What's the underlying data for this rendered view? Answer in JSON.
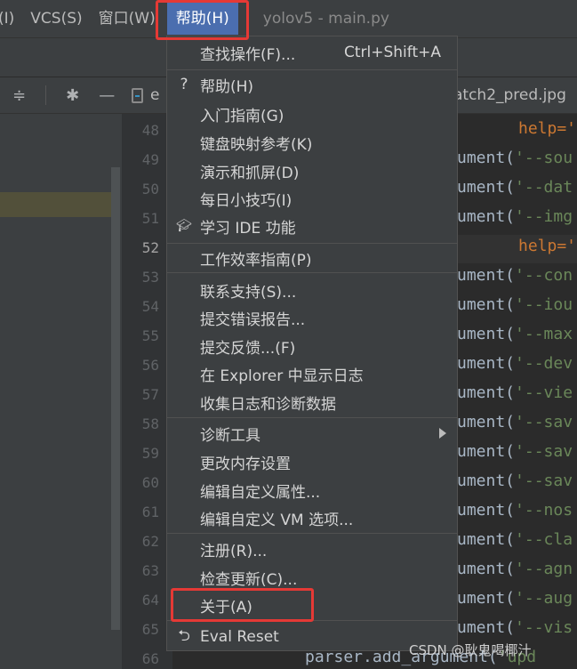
{
  "menubar": {
    "items": [
      "(I)",
      "VCS(S)",
      "窗口(W)"
    ],
    "active_item": "帮助(H)",
    "window_title": "yolov5 - main.py"
  },
  "editor": {
    "tab_left_fragment": "e",
    "tab_right_fragment": "atch2_pred.jpg",
    "line_numbers": [
      "48",
      "49",
      "50",
      "51",
      "52",
      "53",
      "54",
      "55",
      "56",
      "57",
      "58",
      "59",
      "60",
      "61",
      "62",
      "63",
      "64",
      "65",
      "66"
    ],
    "current_line": "52",
    "code_lines": [
      {
        "prefix": "",
        "arg": "help='"
      },
      {
        "prefix": "ument(",
        "arg": "'--sou"
      },
      {
        "prefix": "ument(",
        "arg": "'--dat"
      },
      {
        "prefix": "ument(",
        "arg": "'--img"
      },
      {
        "prefix": "",
        "arg": "help='"
      },
      {
        "prefix": "ument(",
        "arg": "'--con"
      },
      {
        "prefix": "ument(",
        "arg": "'--iou"
      },
      {
        "prefix": "ument(",
        "arg": "'--max"
      },
      {
        "prefix": "ument(",
        "arg": "'--dev"
      },
      {
        "prefix": "ument(",
        "arg": "'--vie"
      },
      {
        "prefix": "ument(",
        "arg": "'--sav"
      },
      {
        "prefix": "ument(",
        "arg": "'--sav"
      },
      {
        "prefix": "ument(",
        "arg": "'--sav"
      },
      {
        "prefix": "ument(",
        "arg": "'--nos"
      },
      {
        "prefix": "ument(",
        "arg": "'--cla"
      },
      {
        "prefix": "ument(",
        "arg": "'--agn"
      },
      {
        "prefix": "ument(",
        "arg": "'--aug"
      },
      {
        "prefix": "ument(",
        "arg": "'--vis"
      },
      {
        "prefix": "parser.add_argument(",
        "arg": "'upd"
      }
    ]
  },
  "help_menu": {
    "find_action": {
      "label": "查找操作(F)...",
      "shortcut": "Ctrl+Shift+A"
    },
    "help": "帮助(H)",
    "getting_started": "入门指南(G)",
    "keymap_reference": "键盘映射参考(K)",
    "demos_screencasts": "演示和抓屏(D)",
    "tip_of_day": "每日小技巧(I)",
    "learn_ide": "学习 IDE 功能",
    "productivity_guide": "工作效率指南(P)",
    "contact_support": "联系支持(S)...",
    "submit_bug": "提交错误报告...",
    "submit_feedback": "提交反馈...(F)",
    "show_log": "在 Explorer 中显示日志",
    "collect_logs": "收集日志和诊断数据",
    "diagnostic_tools": "诊断工具",
    "change_memory": "更改内存设置",
    "edit_properties": "编辑自定义属性...",
    "edit_vm_options": "编辑自定义 VM 选项...",
    "register": "注册(R)...",
    "check_updates": "检查更新(C)...",
    "about": "关于(A)",
    "eval_reset": "Eval Reset"
  },
  "watermark": "CSDN @耿鬼喝椰汁"
}
